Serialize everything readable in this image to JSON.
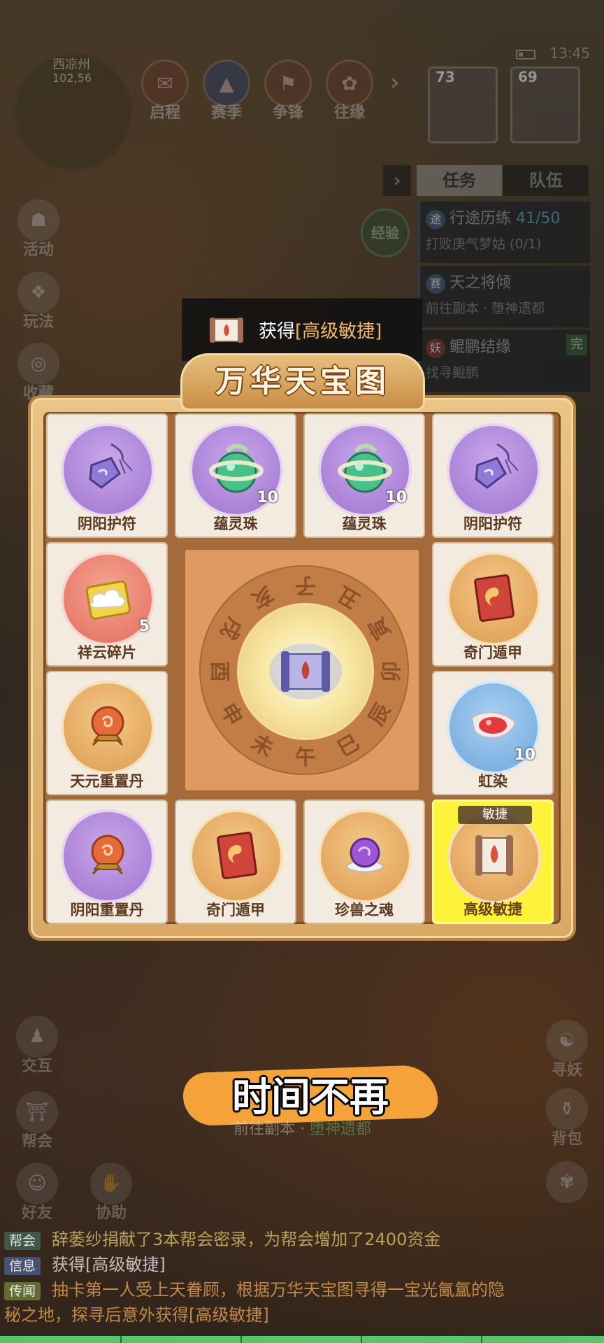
{
  "status": {
    "time": "13:45"
  },
  "map": {
    "name": "西凉州",
    "coord": "102,56"
  },
  "top_menu": [
    {
      "label": "启程",
      "icon": "journey-icon"
    },
    {
      "label": "赛季",
      "icon": "season-icon"
    },
    {
      "label": "争锋",
      "icon": "contest-icon"
    },
    {
      "label": "往缘",
      "icon": "fate-icon"
    }
  ],
  "party": [
    {
      "level": "73"
    },
    {
      "level": "69"
    }
  ],
  "side_left": [
    {
      "label": "活动"
    },
    {
      "label": "玩法"
    },
    {
      "label": "收藏"
    }
  ],
  "quest_panel": {
    "tab_active": "任务",
    "tab_inactive": "队伍",
    "exp_badge": "经验",
    "quests": [
      {
        "tag": "途",
        "title": "行途历练",
        "progress": "41/50",
        "sub": "打败庚气梦姑 (0/1)"
      },
      {
        "tag": "赛",
        "title": "天之将倾",
        "progress": "",
        "sub": "前往副本 · 堕神遗都"
      },
      {
        "tag": "妖",
        "title": "鲲鹏结缘",
        "progress": "",
        "sub": "找寻鲲鹏"
      }
    ],
    "done_badge": "完"
  },
  "toast": {
    "prefix": "获得",
    "item": "[高级敏捷]"
  },
  "board": {
    "title": "万华天宝图",
    "cells": [
      {
        "name": "阴阳护符",
        "count": "",
        "theme": "purple",
        "icon": "amulet-icon"
      },
      {
        "name": "蕴灵珠",
        "count": "10",
        "theme": "purple",
        "icon": "spirit-orb-icon"
      },
      {
        "name": "蕴灵珠",
        "count": "10",
        "theme": "purple",
        "icon": "spirit-orb-icon"
      },
      {
        "name": "阴阳护符",
        "count": "",
        "theme": "purple",
        "icon": "amulet-icon"
      },
      {
        "name": "祥云碎片",
        "count": "5",
        "theme": "red",
        "icon": "cloud-puzzle-icon"
      },
      {
        "name": "奇门遁甲",
        "count": "",
        "theme": "gold",
        "icon": "book-icon"
      },
      {
        "name": "天元重置丹",
        "count": "",
        "theme": "gold",
        "icon": "crystal-ball-icon"
      },
      {
        "name": "虹染",
        "count": "10",
        "theme": "blue",
        "icon": "dye-icon"
      },
      {
        "name": "阴阳重置丹",
        "count": "",
        "theme": "purple",
        "icon": "crystal-ball-icon"
      },
      {
        "name": "奇门遁甲",
        "count": "",
        "theme": "gold",
        "icon": "book-icon"
      },
      {
        "name": "珍兽之魂",
        "count": "",
        "theme": "gold",
        "icon": "beast-soul-icon"
      },
      {
        "name": "高级敏捷",
        "count": "",
        "theme": "gold",
        "icon": "scroll-icon",
        "tag": "敏捷"
      }
    ],
    "dial_chars": [
      "子",
      "丑",
      "寅",
      "卯",
      "辰",
      "巳",
      "午",
      "未",
      "申",
      "酉",
      "戌",
      "亥"
    ]
  },
  "side_bottom_left": [
    {
      "label": "交互"
    },
    {
      "label": "帮会"
    },
    {
      "label": "好友"
    },
    {
      "label": "协助"
    }
  ],
  "side_bottom_right": [
    {
      "label": "寻妖"
    },
    {
      "label": "背包"
    }
  ],
  "subtitle": "时间不再",
  "under_subtitle": {
    "prefix": "前往副本 · ",
    "place": "堕神遗都"
  },
  "chat": [
    {
      "tag": "帮会",
      "text": "辞萎纱捐献了3本帮会密录，为帮会增加了2400资金"
    },
    {
      "tag": "信息",
      "text": "获得[高级敏捷]"
    },
    {
      "tag": "传闻",
      "text": "抽卡第一人受上天眷顾，根据万华天宝图寻得一宝光氤氲的隐"
    },
    {
      "tag": "",
      "text": "秘之地，探寻后意外获得[高级敏捷]"
    }
  ],
  "colors": {
    "board_bg": "#d9a964",
    "cell_bg": "#f3ebdf",
    "selected": "#fff23a",
    "highlight_text": "#f2b866",
    "subtitle_bg": "#f4a33a"
  }
}
